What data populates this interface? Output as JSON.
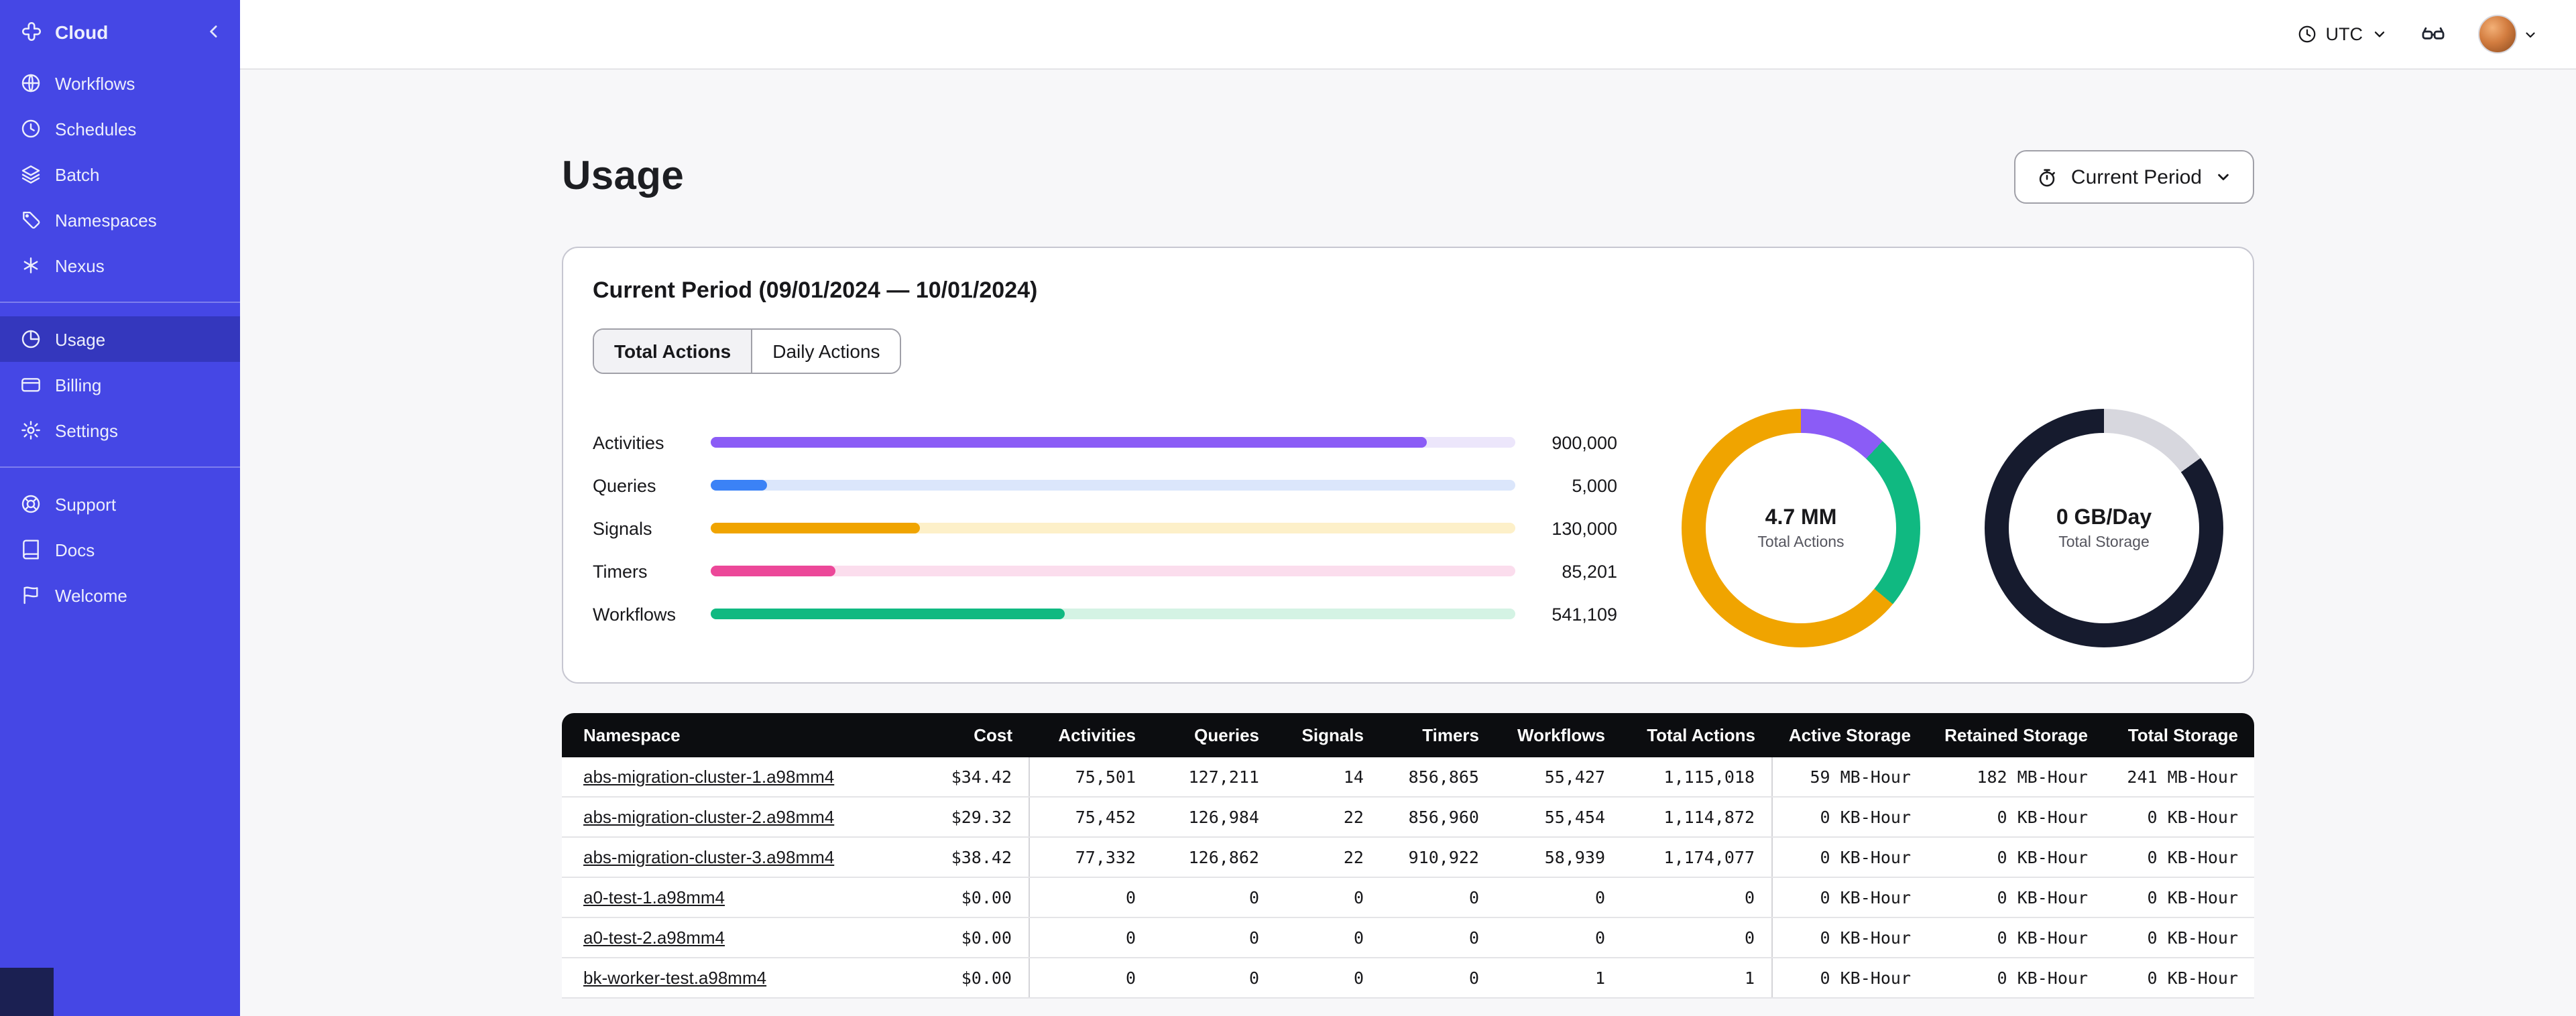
{
  "theme": {
    "sidebar-bg": "#4547e5",
    "sidebar-active": "#3437bd",
    "accent-border": "#a0a0a8",
    "table-header-bg": "#0c0d10",
    "page-bg": "#f7f7f9"
  },
  "sidebar": {
    "brand": "Cloud",
    "groups": [
      {
        "items": [
          {
            "label": "Workflows",
            "icon": "workflows"
          },
          {
            "label": "Schedules",
            "icon": "schedules"
          },
          {
            "label": "Batch",
            "icon": "batch"
          },
          {
            "label": "Namespaces",
            "icon": "namespaces"
          },
          {
            "label": "Nexus",
            "icon": "nexus"
          }
        ]
      },
      {
        "items": [
          {
            "label": "Usage",
            "icon": "usage",
            "active": true
          },
          {
            "label": "Billing",
            "icon": "billing"
          },
          {
            "label": "Settings",
            "icon": "settings"
          }
        ]
      },
      {
        "items": [
          {
            "label": "Support",
            "icon": "support"
          },
          {
            "label": "Docs",
            "icon": "docs"
          },
          {
            "label": "Welcome",
            "icon": "welcome"
          }
        ]
      }
    ]
  },
  "topbar": {
    "timezone": "UTC"
  },
  "page": {
    "title": "Usage",
    "period_button": "Current Period"
  },
  "usage_card": {
    "title": "Current Period (09/01/2024 — 10/01/2024)",
    "tabs": [
      {
        "label": "Total Actions",
        "active": true
      },
      {
        "label": "Daily Actions",
        "active": false
      }
    ]
  },
  "chart_data": [
    {
      "type": "bar",
      "orientation": "horizontal",
      "categories": [
        "Activities",
        "Queries",
        "Signals",
        "Timers",
        "Workflows"
      ],
      "values": [
        900000,
        5000,
        130000,
        85201,
        541109
      ],
      "value_labels": [
        "900,000",
        "5,000",
        "130,000",
        "85,201",
        "541,109"
      ],
      "bar_colors": [
        "#8b5cf6",
        "#3b82f6",
        "#f0a400",
        "#ec4899",
        "#10b981"
      ],
      "track_colors": [
        "#ece6fb",
        "#dbe6fb",
        "#fdf0c9",
        "#fbdded",
        "#d4f3e4"
      ],
      "fill_percent": [
        89,
        7,
        26,
        15.5,
        44
      ],
      "grid": false,
      "legend": "none"
    },
    {
      "type": "pie",
      "style": "donut",
      "center_label": "4.7 MM",
      "center_sublabel": "Total Actions",
      "segments": [
        {
          "color": "#8b5cf6",
          "percent": 12
        },
        {
          "color": "#10b981",
          "percent": 24
        },
        {
          "color": "#f0a400",
          "percent": 64
        }
      ]
    },
    {
      "type": "pie",
      "style": "donut",
      "center_label": "0 GB/Day",
      "center_sublabel": "Total Storage",
      "segments": [
        {
          "color": "#d7d7de",
          "percent": 15
        },
        {
          "color": "#161b2e",
          "percent": 85
        }
      ]
    }
  ],
  "table": {
    "columns": [
      {
        "key": "namespace",
        "label": "Namespace"
      },
      {
        "key": "cost",
        "label": "Cost",
        "group_end": true
      },
      {
        "key": "activities",
        "label": "Activities"
      },
      {
        "key": "queries",
        "label": "Queries"
      },
      {
        "key": "signals",
        "label": "Signals"
      },
      {
        "key": "timers",
        "label": "Timers"
      },
      {
        "key": "workflows",
        "label": "Workflows"
      },
      {
        "key": "total_actions",
        "label": "Total Actions",
        "group_end": true
      },
      {
        "key": "active_storage",
        "label": "Active Storage"
      },
      {
        "key": "retained_storage",
        "label": "Retained Storage"
      },
      {
        "key": "total_storage",
        "label": "Total Storage"
      }
    ],
    "rows": [
      {
        "namespace": "abs-migration-cluster-1.a98mm4",
        "cost": "$34.42",
        "activities": "75,501",
        "queries": "127,211",
        "signals": "14",
        "timers": "856,865",
        "workflows": "55,427",
        "total_actions": "1,115,018",
        "active_storage": "59 MB-Hour",
        "retained_storage": "182 MB-Hour",
        "total_storage": "241 MB-Hour"
      },
      {
        "namespace": "abs-migration-cluster-2.a98mm4",
        "cost": "$29.32",
        "activities": "75,452",
        "queries": "126,984",
        "signals": "22",
        "timers": "856,960",
        "workflows": "55,454",
        "total_actions": "1,114,872",
        "active_storage": "0 KB-Hour",
        "retained_storage": "0 KB-Hour",
        "total_storage": "0 KB-Hour"
      },
      {
        "namespace": "abs-migration-cluster-3.a98mm4",
        "cost": "$38.42",
        "activities": "77,332",
        "queries": "126,862",
        "signals": "22",
        "timers": "910,922",
        "workflows": "58,939",
        "total_actions": "1,174,077",
        "active_storage": "0 KB-Hour",
        "retained_storage": "0 KB-Hour",
        "total_storage": "0 KB-Hour"
      },
      {
        "namespace": "a0-test-1.a98mm4",
        "cost": "$0.00",
        "activities": "0",
        "queries": "0",
        "signals": "0",
        "timers": "0",
        "workflows": "0",
        "total_actions": "0",
        "active_storage": "0 KB-Hour",
        "retained_storage": "0 KB-Hour",
        "total_storage": "0 KB-Hour"
      },
      {
        "namespace": "a0-test-2.a98mm4",
        "cost": "$0.00",
        "activities": "0",
        "queries": "0",
        "signals": "0",
        "timers": "0",
        "workflows": "0",
        "total_actions": "0",
        "active_storage": "0 KB-Hour",
        "retained_storage": "0 KB-Hour",
        "total_storage": "0 KB-Hour"
      },
      {
        "namespace": "bk-worker-test.a98mm4",
        "cost": "$0.00",
        "activities": "0",
        "queries": "0",
        "signals": "0",
        "timers": "0",
        "workflows": "1",
        "total_actions": "1",
        "active_storage": "0 KB-Hour",
        "retained_storage": "0 KB-Hour",
        "total_storage": "0 KB-Hour"
      }
    ]
  }
}
